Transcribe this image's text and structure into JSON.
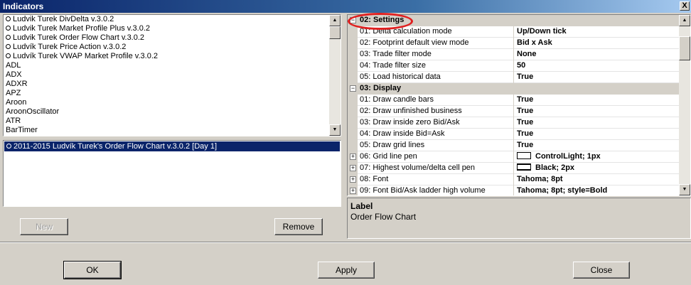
{
  "window": {
    "title": "Indicators",
    "close_glyph": "X"
  },
  "indicator_list": {
    "items": [
      {
        "label": "Ludvik Turek DivDelta v.3.0.2",
        "icon": "radio-icon"
      },
      {
        "label": "Ludvik Turek Market Profile Plus v.3.0.2",
        "icon": "radio-icon"
      },
      {
        "label": "Ludvik Turek Order Flow Chart v.3.0.2",
        "icon": "radio-icon"
      },
      {
        "label": "Ludvík Turek Price Action v.3.0.2",
        "icon": "radio-icon"
      },
      {
        "label": "Ludvík Turek VWAP Market Profile v.3.0.2",
        "icon": "radio-icon"
      },
      {
        "label": "ADL"
      },
      {
        "label": "ADX"
      },
      {
        "label": "ADXR"
      },
      {
        "label": "APZ"
      },
      {
        "label": "Aroon"
      },
      {
        "label": "AroonOscillator"
      },
      {
        "label": "ATR"
      },
      {
        "label": "BarTimer"
      }
    ]
  },
  "applied_list": {
    "selected": "2011-2015 Ludvík Turek's Order Flow Chart v.3.0.2 [Day 1]"
  },
  "buttons": {
    "new": "New",
    "remove": "Remove",
    "ok": "OK",
    "apply": "Apply",
    "close": "Close"
  },
  "properties": {
    "rows": [
      {
        "type": "category",
        "expander": "⊟",
        "name": "02: Settings"
      },
      {
        "type": "prop",
        "name": "01: Delta calculation mode",
        "value": "Up/Down tick"
      },
      {
        "type": "prop",
        "name": "02: Footprint default view mode",
        "value": "Bid x Ask"
      },
      {
        "type": "prop",
        "name": "03: Trade filter mode",
        "value": "None"
      },
      {
        "type": "prop",
        "name": "04: Trade filter size",
        "value": "50"
      },
      {
        "type": "prop",
        "name": "05: Load historical data",
        "value": "True"
      },
      {
        "type": "category",
        "expander": "⊟",
        "name": "03: Display"
      },
      {
        "type": "prop",
        "name": "01: Draw candle bars",
        "value": "True"
      },
      {
        "type": "prop",
        "name": "02: Draw unfinished business",
        "value": "True"
      },
      {
        "type": "prop",
        "name": "03: Draw inside zero Bid/Ask",
        "value": "True"
      },
      {
        "type": "prop",
        "name": "04: Draw inside Bid=Ask",
        "value": "True"
      },
      {
        "type": "prop",
        "name": "05: Draw grid lines",
        "value": "True"
      },
      {
        "type": "prop",
        "expander": "⊞",
        "name": "06: Grid line pen",
        "value": "ControlLight; 1px",
        "pen": "thin"
      },
      {
        "type": "prop",
        "expander": "⊞",
        "name": "07: Highest volume/delta cell pen",
        "value": "Black; 2px",
        "pen": "thick"
      },
      {
        "type": "prop",
        "expander": "⊞",
        "name": "08: Font",
        "value": "Tahoma; 8pt"
      },
      {
        "type": "prop",
        "expander": "⊞",
        "name": "09: Font Bid/Ask ladder high volume",
        "value": "Tahoma; 8pt; style=Bold"
      }
    ]
  },
  "description": {
    "heading": "Label",
    "body": "Order Flow Chart"
  }
}
